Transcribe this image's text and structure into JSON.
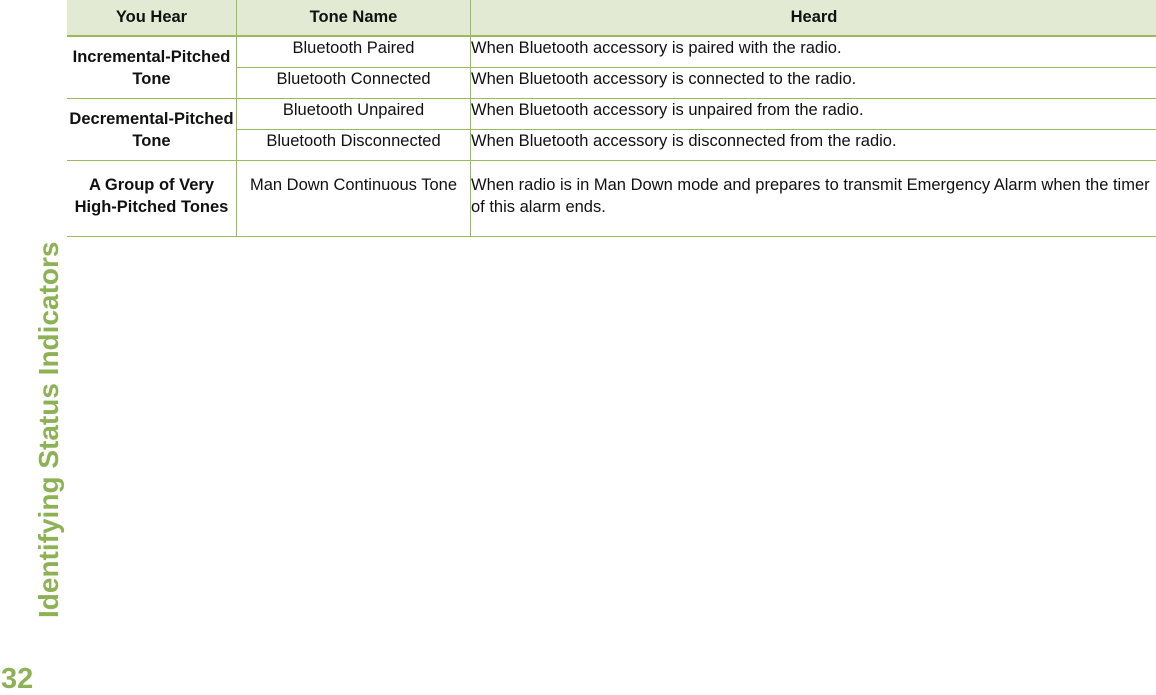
{
  "side_title": "Identifying Status Indicators",
  "page_number": "32",
  "colors": {
    "accent_green": "#8db255",
    "table_border": "#9bbb59",
    "header_fill": "#e2ead3"
  },
  "table": {
    "headers": [
      "You Hear",
      "Tone Name",
      "Heard"
    ],
    "groups": [
      {
        "you_hear": "Incremental-Pitched Tone",
        "rows": [
          {
            "tone_name": "Bluetooth Paired",
            "heard": "When Bluetooth accessory is paired with the radio."
          },
          {
            "tone_name": "Bluetooth Connected",
            "heard": "When Bluetooth accessory is connected to the radio."
          }
        ]
      },
      {
        "you_hear": "Decremental-Pitched Tone",
        "rows": [
          {
            "tone_name": "Bluetooth Unpaired",
            "heard": "When Bluetooth accessory is unpaired from the radio."
          },
          {
            "tone_name": "Bluetooth Disconnected",
            "heard": "When Bluetooth accessory is disconnected from the radio."
          }
        ]
      },
      {
        "you_hear": "A Group of Very High-Pitched Tones",
        "rows": [
          {
            "tone_name": "Man Down Continuous Tone",
            "heard": "When radio is in Man Down mode and prepares to transmit Emergency Alarm when the timer of this alarm ends."
          }
        ]
      }
    ]
  }
}
